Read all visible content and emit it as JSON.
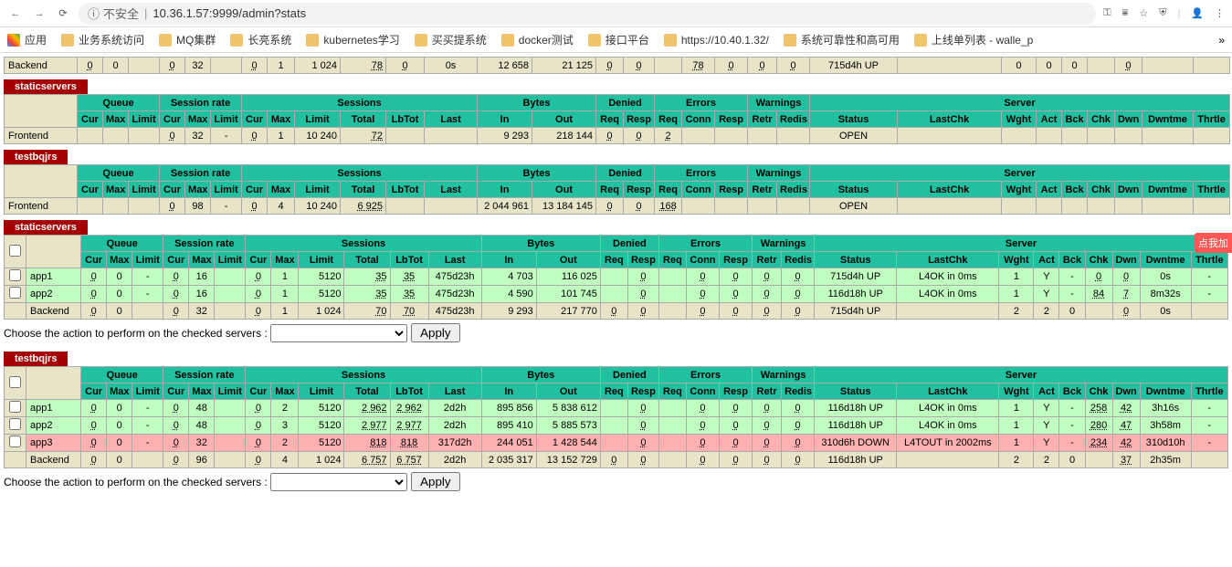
{
  "browser": {
    "insecure_label": "不安全",
    "url": "10.36.1.57:9999/admin?stats",
    "bookmarks": [
      {
        "label": "应用",
        "icon": "apps"
      },
      {
        "label": "业务系统访问"
      },
      {
        "label": "MQ集群"
      },
      {
        "label": "长亮系统"
      },
      {
        "label": "kubernetes学习"
      },
      {
        "label": "买买提系统"
      },
      {
        "label": "docker测试"
      },
      {
        "label": "接口平台"
      },
      {
        "label": "https://10.40.1.32/",
        "icon": "h"
      },
      {
        "label": "系统可靠性和高可用",
        "icon": "doc"
      },
      {
        "label": "上线单列表 - walle_p",
        "icon": "w"
      }
    ]
  },
  "float_badge": "点我加",
  "headers": {
    "groups": [
      "",
      "Queue",
      "Session rate",
      "Sessions",
      "Bytes",
      "Denied",
      "Errors",
      "Warnings",
      "Server"
    ],
    "cols": [
      "",
      "Cur",
      "Max",
      "Limit",
      "Cur",
      "Max",
      "Limit",
      "Cur",
      "Max",
      "Limit",
      "Total",
      "LbTot",
      "Last",
      "In",
      "Out",
      "Req",
      "Resp",
      "Req",
      "Conn",
      "Resp",
      "Retr",
      "Redis",
      "Status",
      "LastChk",
      "Wght",
      "Act",
      "Bck",
      "Chk",
      "Dwn",
      "Dwntme",
      "Thrtle"
    ]
  },
  "action": {
    "label": "Choose the action to perform on the checked servers :",
    "apply": "Apply"
  },
  "section0": {
    "row": {
      "name": "Backend",
      "q_cur": "0",
      "q_max": "0",
      "q_lim": "",
      "sr_cur": "0",
      "sr_max": "32",
      "sr_lim": "",
      "s_cur": "0",
      "s_max": "1",
      "s_lim": "1 024",
      "s_tot": "78",
      "s_lb": "0",
      "s_last": "0s",
      "b_in": "12 658",
      "b_out": "21 125",
      "d_req": "0",
      "d_rsp": "0",
      "e_req": "",
      "e_con": "78",
      "e_rsp": "0",
      "w_ret": "0",
      "w_red": "0",
      "status": "715d4h UP",
      "lastchk": "",
      "wght": "0",
      "act": "0",
      "bck": "0",
      "chk": "",
      "dwn": "0",
      "dwntme": "",
      "thrtle": ""
    }
  },
  "section1": {
    "title": "staticservers",
    "rows": [
      {
        "name": "Frontend",
        "cls": "row-fe",
        "q_cur": "",
        "q_max": "",
        "q_lim": "",
        "sr_cur": "0",
        "sr_max": "32",
        "sr_lim": "-",
        "s_cur": "0",
        "s_max": "1",
        "s_lim": "10 240",
        "s_tot": "72",
        "s_lb": "",
        "s_last": "",
        "b_in": "9 293",
        "b_out": "218 144",
        "d_req": "0",
        "d_rsp": "0",
        "e_req": "2",
        "e_con": "",
        "e_rsp": "",
        "w_ret": "",
        "w_red": "",
        "status": "OPEN",
        "lastchk": "",
        "wght": "",
        "act": "",
        "bck": "",
        "chk": "",
        "dwn": "",
        "dwntme": "",
        "thrtle": ""
      }
    ]
  },
  "section2": {
    "title": "testbqjrs",
    "rows": [
      {
        "name": "Frontend",
        "cls": "row-fe",
        "q_cur": "",
        "q_max": "",
        "q_lim": "",
        "sr_cur": "0",
        "sr_max": "98",
        "sr_lim": "-",
        "s_cur": "0",
        "s_max": "4",
        "s_lim": "10 240",
        "s_tot": "6 925",
        "s_lb": "",
        "s_last": "",
        "b_in": "2 044 961",
        "b_out": "13 184 145",
        "d_req": "0",
        "d_rsp": "0",
        "e_req": "168",
        "e_con": "",
        "e_rsp": "",
        "w_ret": "",
        "w_red": "",
        "status": "OPEN",
        "lastchk": "",
        "wght": "",
        "act": "",
        "bck": "",
        "chk": "",
        "dwn": "",
        "dwntme": "",
        "thrtle": ""
      }
    ]
  },
  "section3": {
    "title": "staticservers",
    "checkable": true,
    "rows": [
      {
        "name": "app1",
        "cls": "row-s",
        "chkbox": true,
        "q_cur": "0",
        "q_max": "0",
        "q_lim": "-",
        "sr_cur": "0",
        "sr_max": "16",
        "sr_lim": "",
        "s_cur": "0",
        "s_max": "1",
        "s_lim": "5120",
        "s_tot": "35",
        "s_lb": "35",
        "s_last": "475d23h",
        "b_in": "4 703",
        "b_out": "116 025",
        "d_req": "",
        "d_rsp": "0",
        "e_req": "",
        "e_con": "0",
        "e_rsp": "0",
        "w_ret": "0",
        "w_red": "0",
        "status": "715d4h UP",
        "lastchk": "L4OK in 0ms",
        "wght": "1",
        "act": "Y",
        "bck": "-",
        "chk": "0",
        "dwn": "0",
        "dwntme": "0s",
        "thrtle": "-"
      },
      {
        "name": "app2",
        "cls": "row-s",
        "chkbox": true,
        "q_cur": "0",
        "q_max": "0",
        "q_lim": "-",
        "sr_cur": "0",
        "sr_max": "16",
        "sr_lim": "",
        "s_cur": "0",
        "s_max": "1",
        "s_lim": "5120",
        "s_tot": "35",
        "s_lb": "35",
        "s_last": "475d23h",
        "b_in": "4 590",
        "b_out": "101 745",
        "d_req": "",
        "d_rsp": "0",
        "e_req": "",
        "e_con": "0",
        "e_rsp": "0",
        "w_ret": "0",
        "w_red": "0",
        "status": "116d18h UP",
        "lastchk": "L4OK in 0ms",
        "wght": "1",
        "act": "Y",
        "bck": "-",
        "chk": "84",
        "dwn": "7",
        "dwntme": "8m32s",
        "thrtle": "-"
      },
      {
        "name": "Backend",
        "cls": "row-be",
        "chkbox": false,
        "q_cur": "0",
        "q_max": "0",
        "q_lim": "",
        "sr_cur": "0",
        "sr_max": "32",
        "sr_lim": "",
        "s_cur": "0",
        "s_max": "1",
        "s_lim": "1 024",
        "s_tot": "70",
        "s_lb": "70",
        "s_last": "475d23h",
        "b_in": "9 293",
        "b_out": "217 770",
        "d_req": "0",
        "d_rsp": "0",
        "e_req": "",
        "e_con": "0",
        "e_rsp": "0",
        "w_ret": "0",
        "w_red": "0",
        "status": "715d4h UP",
        "lastchk": "",
        "wght": "2",
        "act": "2",
        "bck": "0",
        "chk": "",
        "dwn": "0",
        "dwntme": "0s",
        "thrtle": ""
      }
    ]
  },
  "section4": {
    "title": "testbqjrs",
    "checkable": true,
    "rows": [
      {
        "name": "app1",
        "cls": "row-s",
        "chkbox": true,
        "q_cur": "0",
        "q_max": "0",
        "q_lim": "-",
        "sr_cur": "0",
        "sr_max": "48",
        "sr_lim": "",
        "s_cur": "0",
        "s_max": "2",
        "s_lim": "5120",
        "s_tot": "2 962",
        "s_lb": "2 962",
        "s_last": "2d2h",
        "b_in": "895 856",
        "b_out": "5 838 612",
        "d_req": "",
        "d_rsp": "0",
        "e_req": "",
        "e_con": "0",
        "e_rsp": "0",
        "w_ret": "0",
        "w_red": "0",
        "status": "116d18h UP",
        "lastchk": "L4OK in 0ms",
        "wght": "1",
        "act": "Y",
        "bck": "-",
        "chk": "258",
        "dwn": "42",
        "dwntme": "3h16s",
        "thrtle": "-"
      },
      {
        "name": "app2",
        "cls": "row-s",
        "chkbox": true,
        "q_cur": "0",
        "q_max": "0",
        "q_lim": "-",
        "sr_cur": "0",
        "sr_max": "48",
        "sr_lim": "",
        "s_cur": "0",
        "s_max": "3",
        "s_lim": "5120",
        "s_tot": "2 977",
        "s_lb": "2 977",
        "s_last": "2d2h",
        "b_in": "895 410",
        "b_out": "5 885 573",
        "d_req": "",
        "d_rsp": "0",
        "e_req": "",
        "e_con": "0",
        "e_rsp": "0",
        "w_ret": "0",
        "w_red": "0",
        "status": "116d18h UP",
        "lastchk": "L4OK in 0ms",
        "wght": "1",
        "act": "Y",
        "bck": "-",
        "chk": "280",
        "dwn": "47",
        "dwntme": "3h58m",
        "thrtle": "-"
      },
      {
        "name": "app3",
        "cls": "row-d",
        "chkbox": true,
        "q_cur": "0",
        "q_max": "0",
        "q_lim": "-",
        "sr_cur": "0",
        "sr_max": "32",
        "sr_lim": "",
        "s_cur": "0",
        "s_max": "2",
        "s_lim": "5120",
        "s_tot": "818",
        "s_lb": "818",
        "s_last": "317d2h",
        "b_in": "244 051",
        "b_out": "1 428 544",
        "d_req": "",
        "d_rsp": "0",
        "e_req": "",
        "e_con": "0",
        "e_rsp": "0",
        "w_ret": "0",
        "w_red": "0",
        "status": "310d6h DOWN",
        "lastchk": "L4TOUT in 2002ms",
        "wght": "1",
        "act": "Y",
        "bck": "-",
        "chk": "234",
        "dwn": "42",
        "dwntme": "310d10h",
        "thrtle": "-"
      },
      {
        "name": "Backend",
        "cls": "row-be",
        "chkbox": false,
        "q_cur": "0",
        "q_max": "0",
        "q_lim": "",
        "sr_cur": "0",
        "sr_max": "96",
        "sr_lim": "",
        "s_cur": "0",
        "s_max": "4",
        "s_lim": "1 024",
        "s_tot": "6 757",
        "s_lb": "6 757",
        "s_last": "2d2h",
        "b_in": "2 035 317",
        "b_out": "13 152 729",
        "d_req": "0",
        "d_rsp": "0",
        "e_req": "",
        "e_con": "0",
        "e_rsp": "0",
        "w_ret": "0",
        "w_red": "0",
        "status": "116d18h UP",
        "lastchk": "",
        "wght": "2",
        "act": "2",
        "bck": "0",
        "chk": "",
        "dwn": "37",
        "dwntme": "2h35m",
        "thrtle": ""
      }
    ]
  }
}
